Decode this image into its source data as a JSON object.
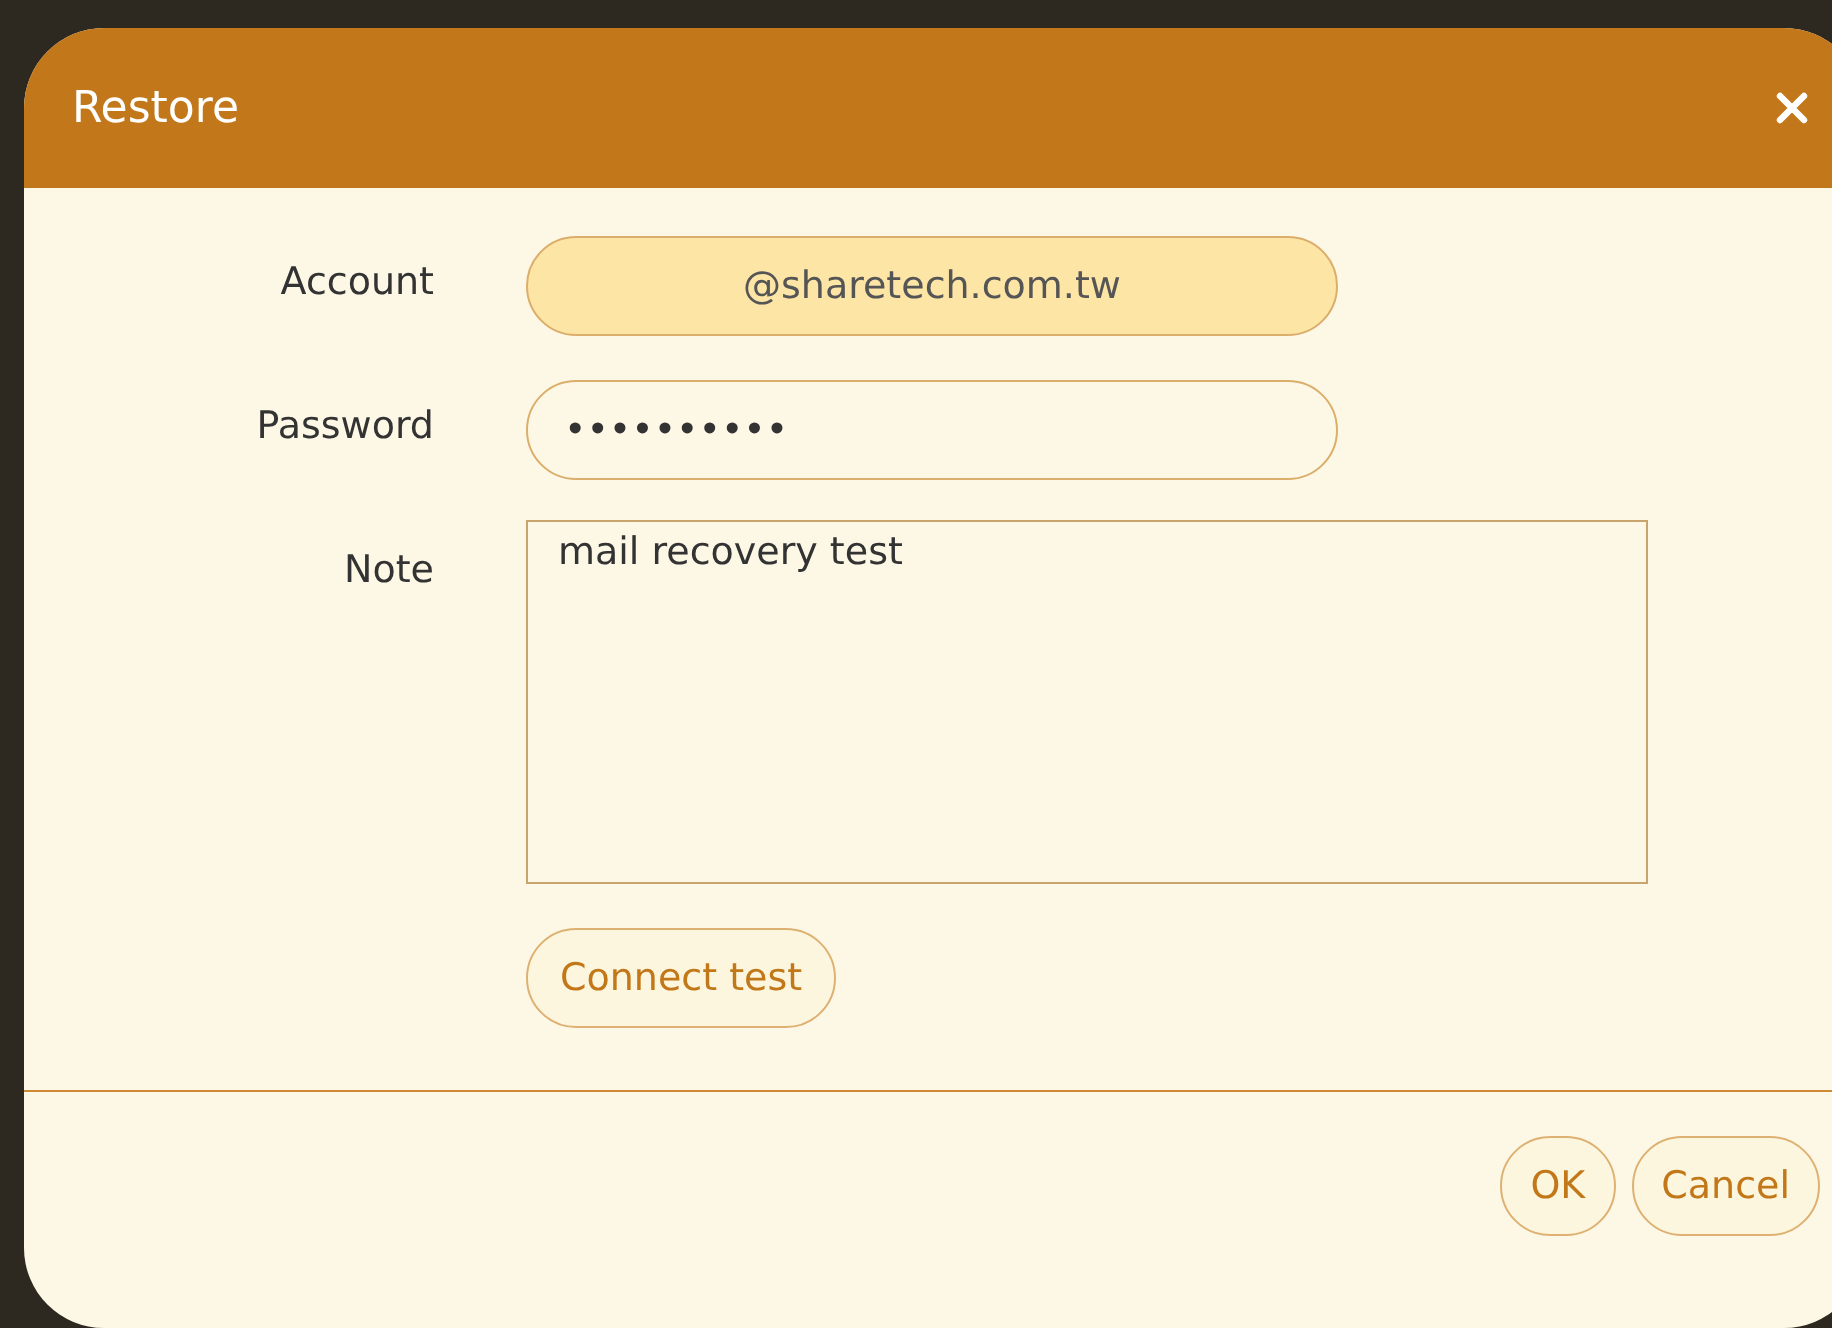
{
  "window": {
    "title": "Restore"
  },
  "fields": [
    {
      "kind": "text",
      "label": "Account",
      "value": "@sharetech.com.tw",
      "disabled": true
    },
    {
      "kind": "text",
      "label": "Password",
      "value": "••••••••••",
      "disabled": false
    },
    {
      "kind": "textarea",
      "label": "Note",
      "value": "mail recovery test",
      "disabled": false
    }
  ],
  "test_button": "Connect test",
  "buttons": [
    "OK",
    "Cancel"
  ]
}
